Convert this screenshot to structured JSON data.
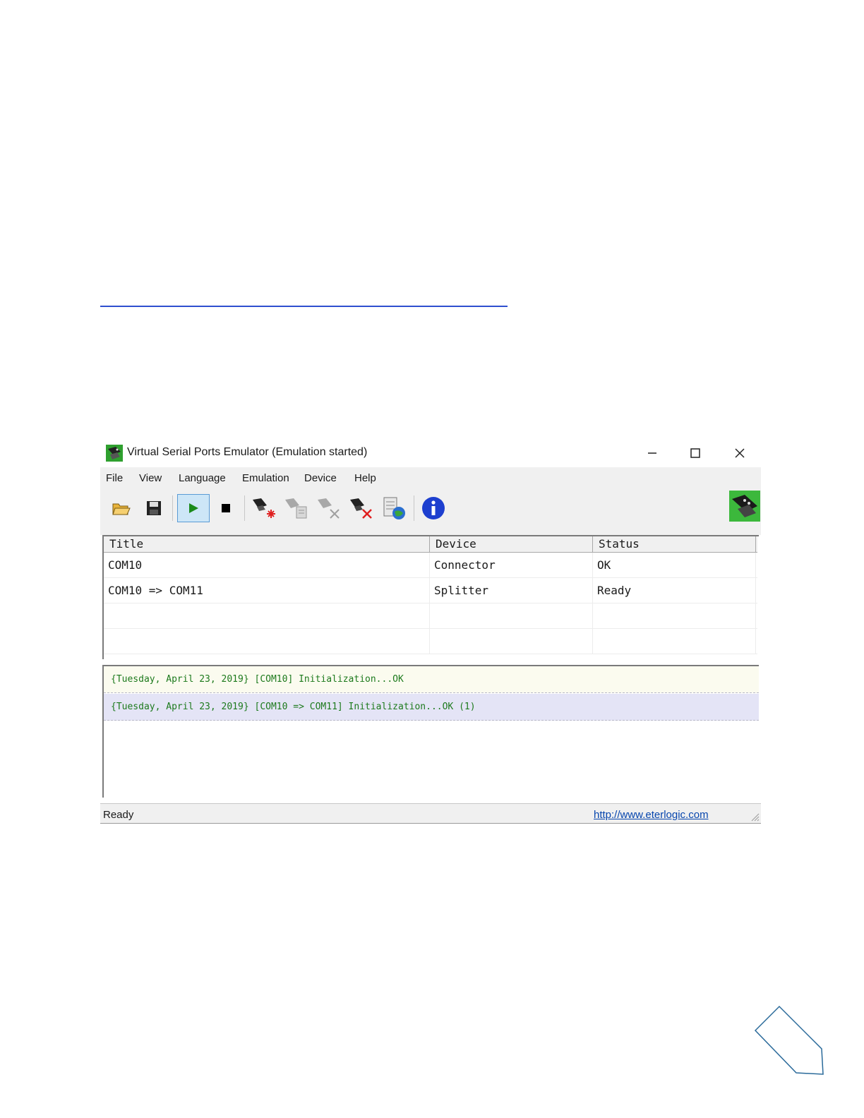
{
  "window": {
    "title": "Virtual Serial Ports Emulator (Emulation started)"
  },
  "menu": [
    "File",
    "View",
    "Language",
    "Emulation",
    "Device",
    "Help"
  ],
  "toolbar": {
    "buttons": [
      {
        "name": "open-folder-icon",
        "color": "#d9a21b"
      },
      {
        "name": "save-disk-icon",
        "color": "#1a1a1a"
      },
      {
        "name": "play-icon",
        "color": "#1a8a1a"
      },
      {
        "name": "stop-icon",
        "color": "#000000"
      },
      {
        "name": "new-device-icon",
        "color": "#e02020"
      },
      {
        "name": "edit-device-icon",
        "color": "#a0a0a0"
      },
      {
        "name": "remove-device-icon",
        "color": "#a0a0a0"
      },
      {
        "name": "delete-device-icon",
        "color": "#e02020"
      },
      {
        "name": "network-settings-icon",
        "color": "#1f5fbf"
      },
      {
        "name": "info-icon",
        "color": "#1d3fcf"
      }
    ]
  },
  "grid": {
    "columns": [
      "Title",
      "Device",
      "Status"
    ],
    "rows": [
      [
        "COM10",
        "Connector",
        "OK"
      ],
      [
        "COM10 => COM11",
        "Splitter",
        "Ready"
      ],
      [
        "",
        "",
        ""
      ],
      [
        "",
        "",
        ""
      ]
    ]
  },
  "log": {
    "lines": [
      "{Tuesday, April 23, 2019} [COM10] Initialization...OK",
      "{Tuesday, April 23, 2019} [COM10 => COM11] Initialization...OK (1)"
    ],
    "color": "#1d7a1d"
  },
  "status": {
    "text": "Ready",
    "link": "http://www.eterlogic.com"
  },
  "colors": {
    "chrome": "#f0f0f0",
    "link": "#0645ad",
    "accent_line": "#2f4fcf",
    "corner_shape": "#2a6a9a"
  }
}
